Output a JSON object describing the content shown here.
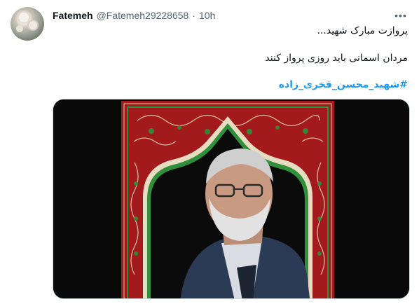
{
  "tweet": {
    "display_name": "Fatemeh",
    "handle": "@Fatemeh29228658",
    "separator": "·",
    "time": "10h",
    "more_label": "•••",
    "lines": [
      "پروازت مبارک شهید...",
      "مردان اسمانی باید روزی پرواز کنند"
    ],
    "hashtag": "#شهید_محسن_فخری_زاده"
  },
  "icons": {
    "more": "more-dots-icon",
    "avatar": "avatar-image"
  },
  "colors": {
    "link": "#1d9bf0",
    "frame_red": "#a31a1c",
    "frame_green": "#2f8f3a",
    "background": "#0a0a0a"
  }
}
